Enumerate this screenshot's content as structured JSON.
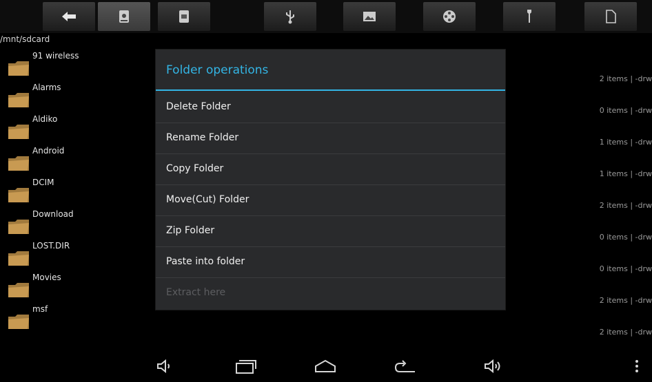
{
  "toolbar": {
    "buttons": [
      {
        "name": "back-icon"
      },
      {
        "name": "internal-storage-icon",
        "active": true
      },
      {
        "name": "sd-card-icon"
      },
      {
        "name": "usb-icon"
      },
      {
        "name": "image-icon"
      },
      {
        "name": "video-icon"
      },
      {
        "name": "tools-icon"
      },
      {
        "name": "document-icon"
      }
    ]
  },
  "path": "/mnt/sdcard",
  "files": [
    {
      "name": "91 wireless",
      "meta": "2 items | -drw"
    },
    {
      "name": "Alarms",
      "meta": "0 items | -drw"
    },
    {
      "name": "Aldiko",
      "meta": "1 items | -drw"
    },
    {
      "name": "Android",
      "meta": "1 items | -drw"
    },
    {
      "name": "DCIM",
      "meta": "2 items | -drw"
    },
    {
      "name": "Download",
      "meta": "0 items | -drw"
    },
    {
      "name": "LOST.DIR",
      "meta": "0 items | -drw"
    },
    {
      "name": "Movies",
      "meta": "2 items | -drw"
    },
    {
      "name": "msf",
      "meta": "2 items | -drw"
    }
  ],
  "dialog": {
    "title": "Folder operations",
    "items": [
      {
        "label": "Delete Folder",
        "enabled": true
      },
      {
        "label": "Rename Folder",
        "enabled": true
      },
      {
        "label": "Copy Folder",
        "enabled": true
      },
      {
        "label": "Move(Cut) Folder",
        "enabled": true
      },
      {
        "label": "Zip Folder",
        "enabled": true
      },
      {
        "label": "Paste into folder",
        "enabled": true
      },
      {
        "label": "Extract here",
        "enabled": false
      }
    ],
    "accent_color": "#33b5e5"
  },
  "navbar": {
    "buttons": [
      "volume-down-icon",
      "recent-apps-icon",
      "home-icon",
      "back-nav-icon",
      "volume-up-icon",
      "overflow-menu-icon"
    ]
  }
}
